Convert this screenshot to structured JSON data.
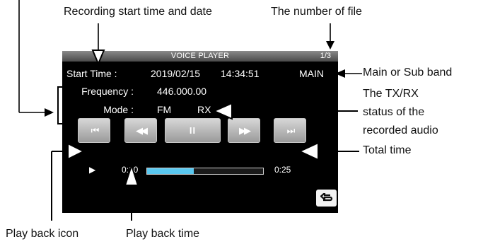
{
  "callouts": {
    "rec_start": "Recording start time and date",
    "file_number": "The number of file",
    "band": "Main or Sub band",
    "txrx_1": "The TX/RX",
    "txrx_2": "status of the",
    "txrx_3": "recorded audio",
    "total_time": "Total time",
    "play_icon": "Play back icon",
    "play_time": "Play back time"
  },
  "screen": {
    "title": "VOICE PLAYER",
    "file_counter": "1/3",
    "start_time_label": "Start Time :",
    "date": "2019/02/15",
    "time": "14:34:51",
    "band": "MAIN",
    "frequency_label": "Frequency :",
    "frequency": "446.000.00",
    "mode_label": "Mode :",
    "mode": "FM",
    "txrx": "RX",
    "play_icon": "▶",
    "elapsed": "0:10",
    "total": "0:25",
    "progress": 0.4
  },
  "buttons": [
    {
      "name": "skip-back-button",
      "icon": "|◀◀",
      "glyph": "⏮"
    },
    {
      "name": "rewind-button",
      "icon": "◀◀",
      "glyph": "◀◀"
    },
    {
      "name": "pause-button",
      "icon": "pause",
      "glyph": "II"
    },
    {
      "name": "fast-forward-button",
      "icon": "▶▶",
      "glyph": "▶▶"
    },
    {
      "name": "skip-forward-button",
      "icon": "▶▶|",
      "glyph": "⏭"
    }
  ],
  "colors": {
    "screen_bg": "#000000",
    "progress": "#5ac8f0",
    "button": "#b8b8b8"
  }
}
